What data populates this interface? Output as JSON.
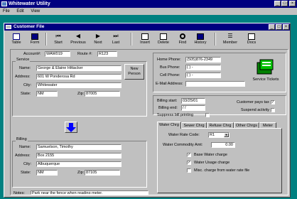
{
  "app": {
    "title": "Whitewater Utility",
    "menu": [
      "File",
      "Edit",
      "View"
    ]
  },
  "window": {
    "title": "Customer File"
  },
  "toolbar": [
    {
      "label": "Table",
      "icon": "table-icon"
    },
    {
      "label": "Form",
      "icon": "form-icon"
    },
    {
      "label": "Start",
      "icon": "first-record-icon"
    },
    {
      "label": "Previous",
      "icon": "previous-record-icon"
    },
    {
      "label": "Next",
      "icon": "next-record-icon"
    },
    {
      "label": "Last",
      "icon": "last-record-icon"
    },
    {
      "label": "Insert",
      "icon": "insert-icon"
    },
    {
      "label": "Delete",
      "icon": "delete-icon"
    },
    {
      "label": "Find",
      "icon": "find-icon"
    },
    {
      "label": "History",
      "icon": "history-icon"
    },
    {
      "label": "Member",
      "icon": "member-icon"
    },
    {
      "label": "Docs",
      "icon": "docs-icon"
    }
  ],
  "account": {
    "account_label": "Account#:",
    "account_value": "WAW019",
    "route_label": "Route #:",
    "route_value": "R123"
  },
  "service": {
    "group_title": "Service",
    "name_label": "Name:",
    "name_value": "George & Elaine Hittacker",
    "address_label": "Address:",
    "address_value": "601 W Ponderosa Rd",
    "city_label": "City:",
    "city_value": "Whitewater",
    "state_label": "State:",
    "state_value": "NM",
    "zip_label": "Zip:",
    "zip_value": "87005",
    "new_person_line1": "New",
    "new_person_line2": "Person"
  },
  "billing": {
    "group_title": "Billing",
    "name_label": "Name:",
    "name_value": "Samuelson, Timothy",
    "address_label": "Address:",
    "address_value": "Box 2155",
    "city_label": "City:",
    "city_value": "Albuquerque",
    "state_label": "State:",
    "state_value": "NM",
    "zip_label": "Zip:",
    "zip_value": "87105"
  },
  "notes": {
    "label": "Notes:",
    "value": "Park near the fence when reading meter."
  },
  "phones": {
    "home_label": "Home Phone:",
    "home_value": "(505)876-2349",
    "bus_label": "Bus Phone:",
    "bus_value": "(   )   -",
    "cell_label": "Cell Phone:",
    "cell_value": "(   )   -",
    "email_label": "E-Mail Address:",
    "email_value": "",
    "service_tickets_label": "Service Tickets"
  },
  "billing_dates": {
    "start_label": "Billing start:",
    "start_value": "03/25/01",
    "end_label": "Billing end:",
    "end_value": " / /",
    "suppress_label": "Suppress bill printing",
    "suppress_checked": false,
    "tax_label": "Customer pays tax",
    "tax_checked": true,
    "suspend_label": "Suspend activity",
    "suspend_checked": false
  },
  "tabs": [
    "Water Chrg",
    "Sewer Chrg",
    "Refuse Chrg",
    "Other Chrgs",
    "Meter"
  ],
  "water_charge": {
    "rate_label": "Water Rate Code:",
    "rate_value": "R1",
    "commodity_label": "Water Commodity Amt:",
    "commodity_value": "0.00",
    "base_label": "Base Water charge",
    "base_checked": true,
    "usage_label": "Water Usage charge",
    "usage_checked": true,
    "misc_label": "Misc. charge from water rate file",
    "misc_checked": false
  }
}
